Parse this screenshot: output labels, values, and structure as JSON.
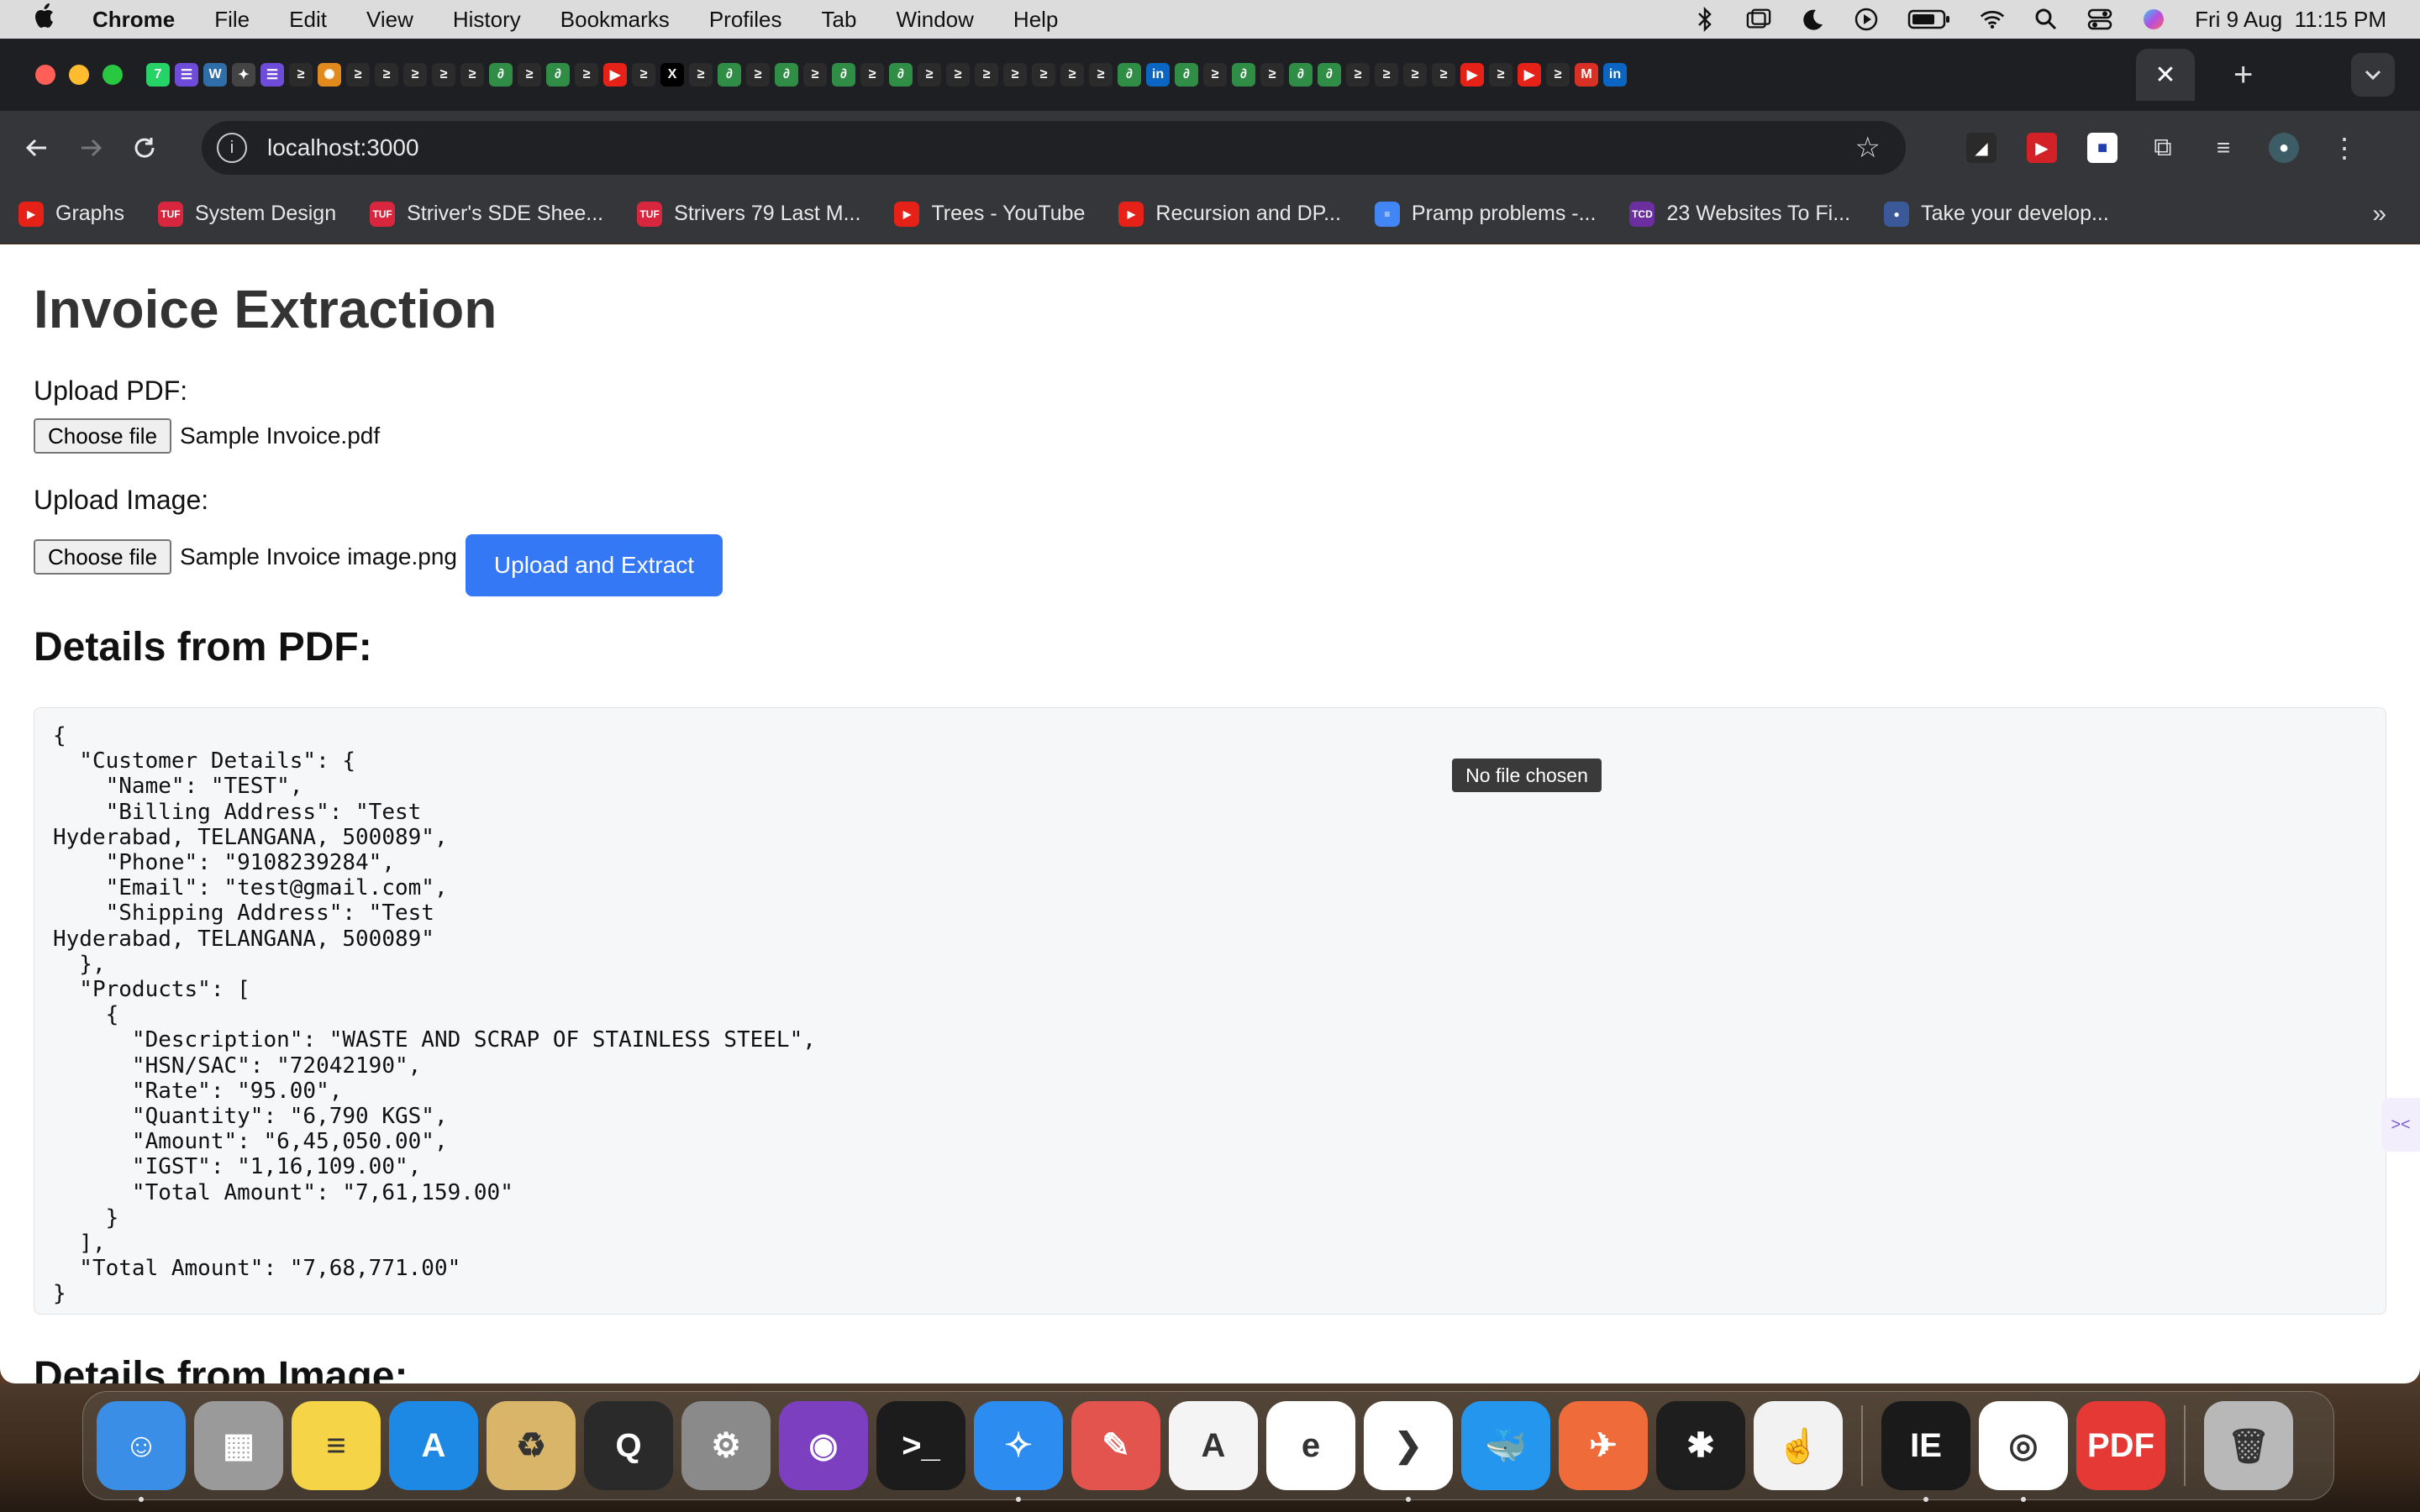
{
  "menubar": {
    "app_name": "Chrome",
    "items": [
      "File",
      "Edit",
      "View",
      "History",
      "Bookmarks",
      "Profiles",
      "Tab",
      "Window",
      "Help"
    ],
    "datetime": "Fri 9 Aug  11:15 PM"
  },
  "tabstrip": {
    "active_tab_close": "✕",
    "new_tab": "+",
    "tab_favicons": [
      {
        "icon": "whatsapp-icon",
        "color": "#25d366",
        "glyph": "7"
      },
      {
        "icon": "list-icon",
        "color": "#6e4bd8",
        "glyph": "☰"
      },
      {
        "icon": "w-icon",
        "color": "#2f6ea8",
        "glyph": "W"
      },
      {
        "icon": "rocket-icon",
        "color": "#444",
        "glyph": "✦"
      },
      {
        "icon": "list-icon",
        "color": "#6e4bd8",
        "glyph": "☰"
      },
      {
        "icon": "leetcode-icon",
        "color": "#2b2b2b",
        "glyph": "≥"
      },
      {
        "icon": "stripes-icon",
        "color": "#e08a1e",
        "glyph": "✺"
      },
      {
        "icon": "leetcode-icon",
        "color": "#2b2b2b",
        "glyph": "≥"
      },
      {
        "icon": "leetcode-icon",
        "color": "#2b2b2b",
        "glyph": "≥"
      },
      {
        "icon": "leetcode-icon",
        "color": "#2b2b2b",
        "glyph": "≥"
      },
      {
        "icon": "leetcode-icon",
        "color": "#2b2b2b",
        "glyph": "≥"
      },
      {
        "icon": "leetcode-icon",
        "color": "#2b2b2b",
        "glyph": "≥"
      },
      {
        "icon": "greeks-icon",
        "color": "#2f8d46",
        "glyph": "∂"
      },
      {
        "icon": "leetcode-icon",
        "color": "#2b2b2b",
        "glyph": "≥"
      },
      {
        "icon": "greeks-icon",
        "color": "#2f8d46",
        "glyph": "∂"
      },
      {
        "icon": "leetcode-icon",
        "color": "#2b2b2b",
        "glyph": "≥"
      },
      {
        "icon": "youtube-icon",
        "color": "#e62117",
        "glyph": "▶"
      },
      {
        "icon": "leetcode-icon",
        "color": "#2b2b2b",
        "glyph": "≥"
      },
      {
        "icon": "x-icon",
        "color": "#000000",
        "glyph": "X"
      },
      {
        "icon": "leetcode-icon",
        "color": "#2b2b2b",
        "glyph": "≥"
      },
      {
        "icon": "greeks-icon",
        "color": "#2f8d46",
        "glyph": "∂"
      },
      {
        "icon": "leetcode-icon",
        "color": "#2b2b2b",
        "glyph": "≥"
      },
      {
        "icon": "greeks-icon",
        "color": "#2f8d46",
        "glyph": "∂"
      },
      {
        "icon": "leetcode-icon",
        "color": "#2b2b2b",
        "glyph": "≥"
      },
      {
        "icon": "greeks-icon",
        "color": "#2f8d46",
        "glyph": "∂"
      },
      {
        "icon": "leetcode-icon",
        "color": "#2b2b2b",
        "glyph": "≥"
      },
      {
        "icon": "greeks-icon",
        "color": "#2f8d46",
        "glyph": "∂"
      },
      {
        "icon": "leetcode-icon",
        "color": "#2b2b2b",
        "glyph": "≥"
      },
      {
        "icon": "leetcode-icon",
        "color": "#2b2b2b",
        "glyph": "≥"
      },
      {
        "icon": "leetcode-icon",
        "color": "#2b2b2b",
        "glyph": "≥"
      },
      {
        "icon": "leetcode-icon",
        "color": "#2b2b2b",
        "glyph": "≥"
      },
      {
        "icon": "leetcode-icon",
        "color": "#2b2b2b",
        "glyph": "≥"
      },
      {
        "icon": "leetcode-icon",
        "color": "#2b2b2b",
        "glyph": "≥"
      },
      {
        "icon": "leetcode-icon",
        "color": "#2b2b2b",
        "glyph": "≥"
      },
      {
        "icon": "greeks-icon",
        "color": "#2f8d46",
        "glyph": "∂"
      },
      {
        "icon": "linkedin-icon",
        "color": "#0a66c2",
        "glyph": "in"
      },
      {
        "icon": "greeks-icon",
        "color": "#2f8d46",
        "glyph": "∂"
      },
      {
        "icon": "leetcode-icon",
        "color": "#2b2b2b",
        "glyph": "≥"
      },
      {
        "icon": "greeks-icon",
        "color": "#2f8d46",
        "glyph": "∂"
      },
      {
        "icon": "leetcode-icon",
        "color": "#2b2b2b",
        "glyph": "≥"
      },
      {
        "icon": "greeks-icon",
        "color": "#2f8d46",
        "glyph": "∂"
      },
      {
        "icon": "greeks-icon",
        "color": "#2f8d46",
        "glyph": "∂"
      },
      {
        "icon": "leetcode-icon",
        "color": "#2b2b2b",
        "glyph": "≥"
      },
      {
        "icon": "leetcode-icon",
        "color": "#2b2b2b",
        "glyph": "≥"
      },
      {
        "icon": "leetcode-icon",
        "color": "#2b2b2b",
        "glyph": "≥"
      },
      {
        "icon": "leetcode-icon",
        "color": "#2b2b2b",
        "glyph": "≥"
      },
      {
        "icon": "youtube-icon",
        "color": "#e62117",
        "glyph": "▶"
      },
      {
        "icon": "leetcode-icon",
        "color": "#2b2b2b",
        "glyph": "≥"
      },
      {
        "icon": "youtube-icon",
        "color": "#e62117",
        "glyph": "▶"
      },
      {
        "icon": "leetcode-icon",
        "color": "#2b2b2b",
        "glyph": "≥"
      },
      {
        "icon": "gmail-icon",
        "color": "#d93025",
        "glyph": "M"
      },
      {
        "icon": "linkedin-icon",
        "color": "#0a66c2",
        "glyph": "in"
      }
    ]
  },
  "toolbar": {
    "url": "localhost:3000"
  },
  "bookmarks": [
    {
      "label": "Graphs",
      "icon": "youtube-icon",
      "color": "#e62117",
      "glyph": "▶"
    },
    {
      "label": "System Design",
      "icon": "tuf-icon",
      "color": "#d7263d",
      "glyph": "TUF"
    },
    {
      "label": "Striver's SDE Shee...",
      "icon": "tuf-icon",
      "color": "#d7263d",
      "glyph": "TUF"
    },
    {
      "label": "Strivers 79 Last M...",
      "icon": "tuf-icon",
      "color": "#d7263d",
      "glyph": "TUF"
    },
    {
      "label": "Trees - YouTube",
      "icon": "youtube-icon",
      "color": "#e62117",
      "glyph": "▶"
    },
    {
      "label": "Recursion and DP...",
      "icon": "youtube-icon",
      "color": "#e62117",
      "glyph": "▶"
    },
    {
      "label": "Pramp problems -...",
      "icon": "docs-icon",
      "color": "#4285f4",
      "glyph": "≡"
    },
    {
      "label": "23 Websites To Fi...",
      "icon": "codedose-icon",
      "color": "#6b2fa0",
      "glyph": "TCD"
    },
    {
      "label": "Take your develop...",
      "icon": "avatar-icon",
      "color": "#3b5998",
      "glyph": "●"
    }
  ],
  "page": {
    "title": "Invoice Extraction",
    "upload_pdf_label": "Upload PDF:",
    "pdf_choose_label": "Choose file",
    "pdf_filename": "Sample Invoice.pdf",
    "upload_image_label": "Upload Image:",
    "image_choose_label": "Choose file",
    "image_filename": "Sample Invoice image.png",
    "upload_button_label": "Upload and Extract",
    "pdf_details_heading": "Details from PDF:",
    "pdf_details_json": "{\n  \"Customer Details\": {\n    \"Name\": \"TEST\",\n    \"Billing Address\": \"Test\nHyderabad, TELANGANA, 500089\",\n    \"Phone\": \"9108239284\",\n    \"Email\": \"test@gmail.com\",\n    \"Shipping Address\": \"Test\nHyderabad, TELANGANA, 500089\"\n  },\n  \"Products\": [\n    {\n      \"Description\": \"WASTE AND SCRAP OF STAINLESS STEEL\",\n      \"HSN/SAC\": \"72042190\",\n      \"Rate\": \"95.00\",\n      \"Quantity\": \"6,790 KGS\",\n      \"Amount\": \"6,45,050.00\",\n      \"IGST\": \"1,16,109.00\",\n      \"Total Amount\": \"7,61,159.00\"\n    }\n  ],\n  \"Total Amount\": \"7,68,771.00\"\n}",
    "tooltip": "No file chosen",
    "image_details_heading": "Details from Image:"
  },
  "dock": {
    "apps": [
      {
        "name": "finder-icon",
        "color": "#3a8ee6",
        "glyph": "☺"
      },
      {
        "name": "launchpad-icon",
        "color": "#9a9a9a",
        "glyph": "▦"
      },
      {
        "name": "notes-icon",
        "color": "#f5d547",
        "glyph": "≡"
      },
      {
        "name": "app-store-icon",
        "color": "#1e88e5",
        "glyph": "A"
      },
      {
        "name": "recycle-icon",
        "color": "#d9b56a",
        "glyph": "♻"
      },
      {
        "name": "quicktime-icon",
        "color": "#2a2a2a",
        "glyph": "Q"
      },
      {
        "name": "system-settings-icon",
        "color": "#8a8a8a",
        "glyph": "⚙"
      },
      {
        "name": "github-desktop-icon",
        "color": "#7b3fbf",
        "glyph": "◉"
      },
      {
        "name": "terminal-icon",
        "color": "#1c1c1c",
        "glyph": ">_"
      },
      {
        "name": "safari-icon",
        "color": "#2d8cf0",
        "glyph": "✧"
      },
      {
        "name": "gestures-icon",
        "color": "#e2544d",
        "glyph": "✎"
      },
      {
        "name": "android-studio-icon",
        "color": "#f4f4f4",
        "glyph": "A"
      },
      {
        "name": "edge-icon",
        "color": "#ffffff",
        "glyph": "e"
      },
      {
        "name": "vscode-icon",
        "color": "#ffffff",
        "glyph": "❯"
      },
      {
        "name": "docker-icon",
        "color": "#2496ed",
        "glyph": "🐳"
      },
      {
        "name": "postman-icon",
        "color": "#ef6c3a",
        "glyph": "✈"
      },
      {
        "name": "figma-icon",
        "color": "#1e1e1e",
        "glyph": "✱"
      },
      {
        "name": "accessibility-icon",
        "color": "#f2f2f2",
        "glyph": "☝"
      },
      {
        "name": "intellij-icon",
        "color": "#1a1a1a",
        "glyph": "IE"
      },
      {
        "name": "chrome-icon",
        "color": "#ffffff",
        "glyph": "◎"
      },
      {
        "name": "pdf-expert-icon",
        "color": "#e53935",
        "glyph": "PDF"
      },
      {
        "name": "trash-icon",
        "color": "#b8b8b8",
        "glyph": "🗑"
      }
    ]
  }
}
